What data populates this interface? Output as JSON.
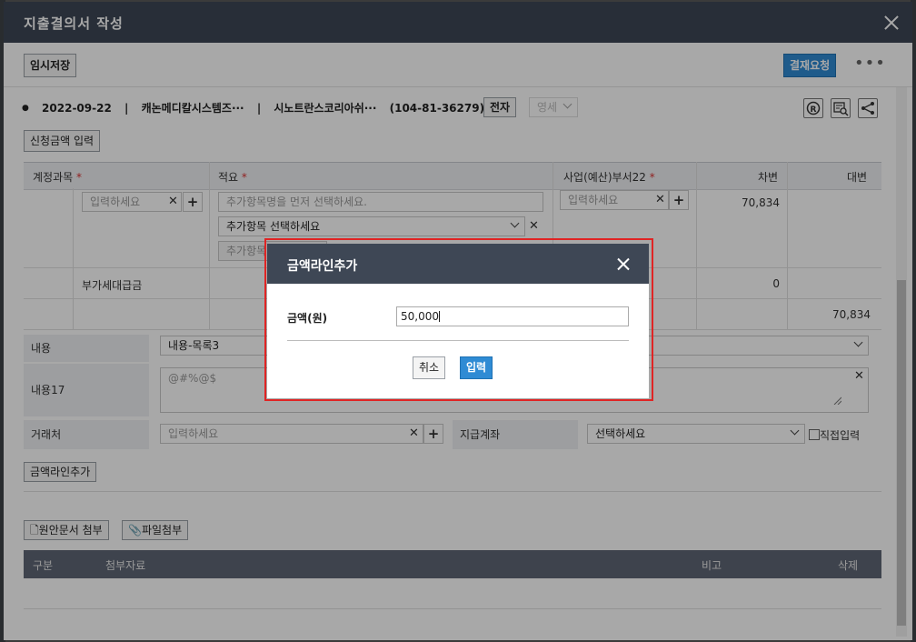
{
  "window": {
    "title": "지출결의서 작성"
  },
  "toolbar": {
    "temp_save": "임시저장",
    "approval_request": "결재요청",
    "more": "•••"
  },
  "info": {
    "date": "2022-09-22",
    "sep1": "|",
    "company": "캐논메디칼시스템즈···",
    "sep2": "|",
    "vendor": "시노트란스코리아쉬···",
    "reg_no": "(104-81-36279)",
    "electronic_btn": "전자",
    "detail_select": "영세"
  },
  "request_amount_btn": "신청금액 입력",
  "table": {
    "headers": {
      "account": "계정과목",
      "summary": "적요",
      "dept": "사업(예산)부서22",
      "debit": "차변",
      "credit": "대변"
    },
    "required_mark": "*",
    "row1": {
      "account_placeholder": "입력하세요",
      "summary_placeholder": "추가항목명을 먼저 선택하세요.",
      "summary_select": "추가항목 선택하세요",
      "summary_partial": "추가항목",
      "dept_placeholder": "입력하세요",
      "debit": "70,834"
    },
    "row2": {
      "account": "부가세대급금",
      "debit": "0"
    },
    "row3": {
      "credit": "70,834"
    }
  },
  "form": {
    "content_label": "내용",
    "content_value": "내용-목록3",
    "content17_label": "내용17",
    "content17_value": "@#%@$",
    "vendor_label": "거래처",
    "vendor_placeholder": "입력하세요",
    "account_label": "지급계좌",
    "account_select": "선택하세요",
    "direct_input": "직접입력"
  },
  "add_amount_line_btn": "금액라인추가",
  "attachments": {
    "original_doc_btn": "원안문서 첨부",
    "file_btn": "파일첨부",
    "headers": {
      "type": "구분",
      "material": "첨부자료",
      "note": "비고",
      "delete": "삭제"
    }
  },
  "modal": {
    "title": "금액라인추가",
    "amount_label": "금액(원)",
    "amount_value": "50,000",
    "cancel": "취소",
    "submit": "입력"
  },
  "colors": {
    "header_bg": "#3e4755",
    "primary_blue": "#2f8bd4",
    "highlight_red": "#e02424"
  }
}
